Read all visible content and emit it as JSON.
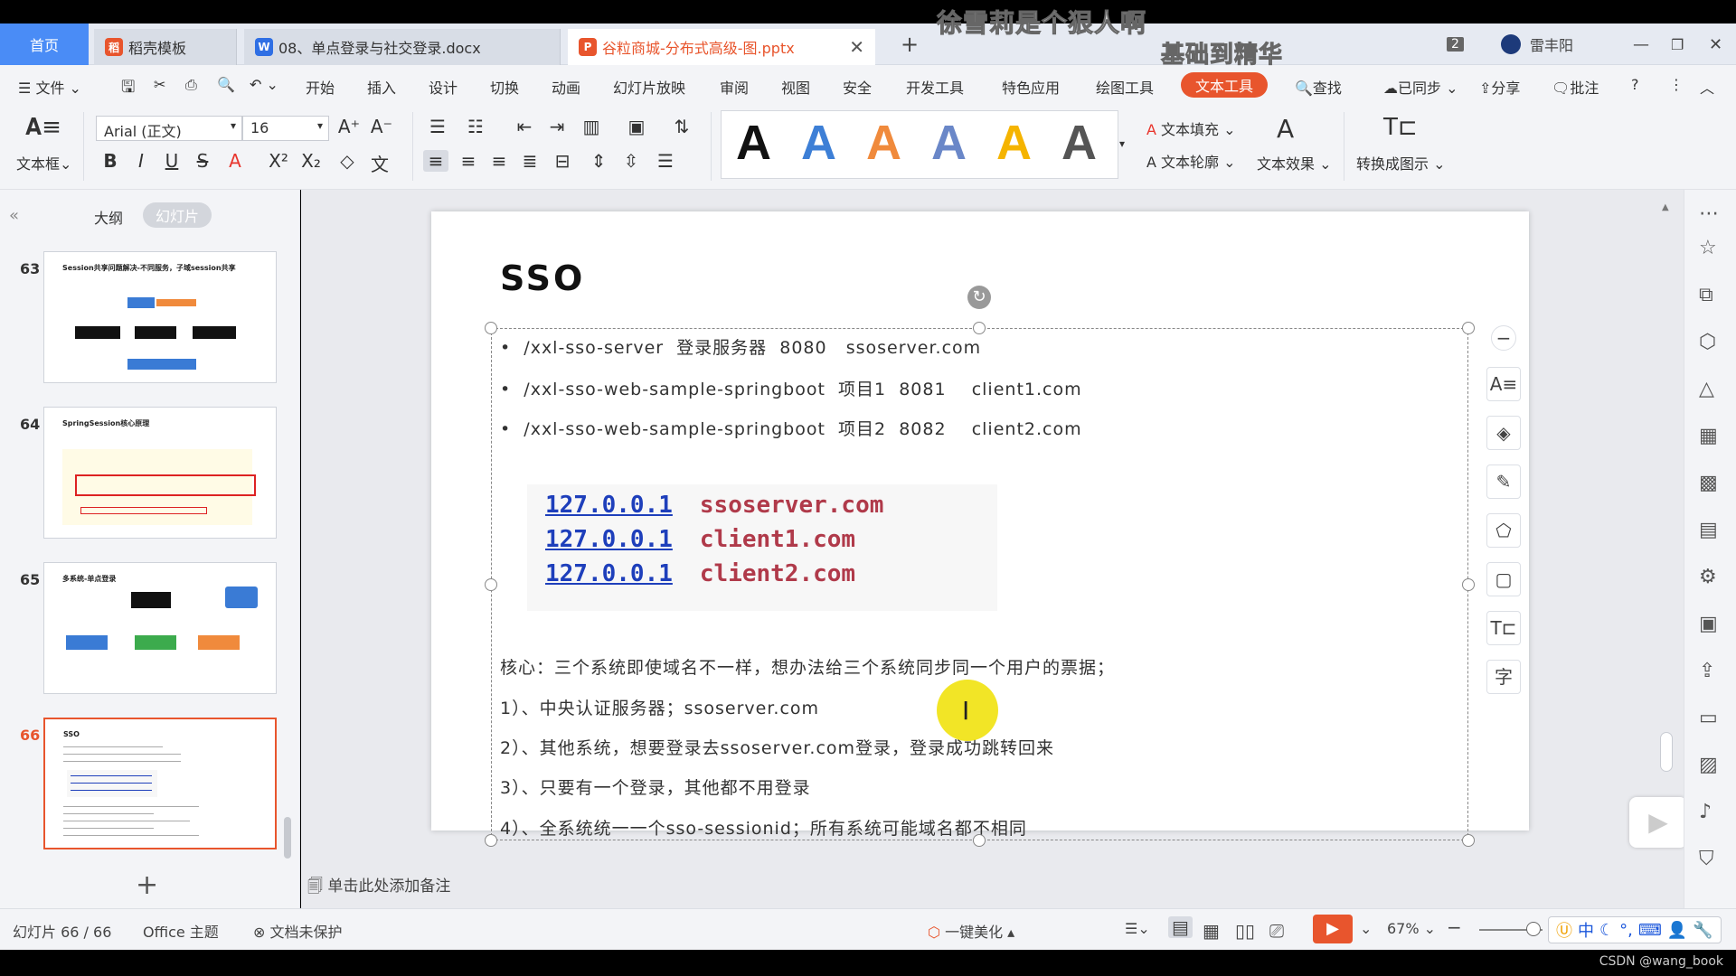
{
  "overlay": {
    "line1": "徐雪莉是个狠人啊",
    "line2": "基础到精华"
  },
  "titlebar": {
    "home_tab": "首页",
    "tabs": [
      {
        "icon": "稻",
        "label": "稻壳模板"
      },
      {
        "icon": "W",
        "label": "08、单点登录与社交登录.docx"
      },
      {
        "icon": "P",
        "label": "谷粒商城-分布式高级-图.pptx"
      }
    ],
    "new_tab": "+",
    "badge": "2",
    "user": "雷丰阳"
  },
  "menubar": {
    "file": "文件",
    "items": [
      "开始",
      "插入",
      "设计",
      "切换",
      "动画",
      "幻灯片放映",
      "审阅",
      "视图",
      "安全",
      "开发工具",
      "特色应用",
      "绘图工具"
    ],
    "active": "文本工具",
    "search": "查找",
    "sync": "已同步",
    "share": "分享",
    "comment": "批注"
  },
  "ribbon": {
    "textbox": "文本框",
    "font_name": "Arial (正文)",
    "font_size": "16",
    "text_fill": "文本填充",
    "text_outline": "文本轮廓",
    "text_effect": "文本效果",
    "convert": "转换成图示",
    "style_colors": [
      "#111111",
      "#3d7fd6",
      "#f08a3c",
      "#6a87c8",
      "#f5b400",
      "#555555"
    ]
  },
  "leftpanel": {
    "tab_outline": "大纲",
    "tab_slides": "幻灯片",
    "thumbs": [
      {
        "num": "63",
        "title": "Session共享问题解决-不同服务，子域session共享"
      },
      {
        "num": "64",
        "title": "SpringSession核心原理"
      },
      {
        "num": "65",
        "title": "多系统-单点登录"
      },
      {
        "num": "66",
        "title": "SSO"
      }
    ],
    "add": "+"
  },
  "slide": {
    "title": "SSO",
    "bullets": [
      "/xxl-sso-server  登录服务器  8080   ssoserver.com",
      "/xxl-sso-web-sample-springboot  项目1  8081    client1.com",
      "/xxl-sso-web-sample-springboot  项目2  8082    client2.com"
    ],
    "hosts": [
      {
        "ip": "127.0.0.1",
        "name": "ssoserver.com"
      },
      {
        "ip": "127.0.0.1",
        "name": "client1.com"
      },
      {
        "ip": "127.0.0.1",
        "name": "client2.com"
      }
    ],
    "core": [
      "核心：三个系统即使域名不一样，想办法给三个系统同步同一个用户的票据；",
      "1）、中央认证服务器；ssoserver.com",
      "2）、其他系统，想要登录去ssoserver.com登录，登录成功跳转回来",
      "3）、只要有一个登录，其他都不用登录",
      "4）、全系统统一一个sso-sessionid；所有系统可能域名都不相同"
    ]
  },
  "notes_placeholder": "单击此处添加备注",
  "statusbar": {
    "slide_info": "幻灯片 66 / 66",
    "theme": "Office 主题",
    "protect": "文档未保护",
    "beautify": "一键美化",
    "zoom": "67%",
    "ime": "中"
  },
  "watermark": "CSDN @wang_book"
}
